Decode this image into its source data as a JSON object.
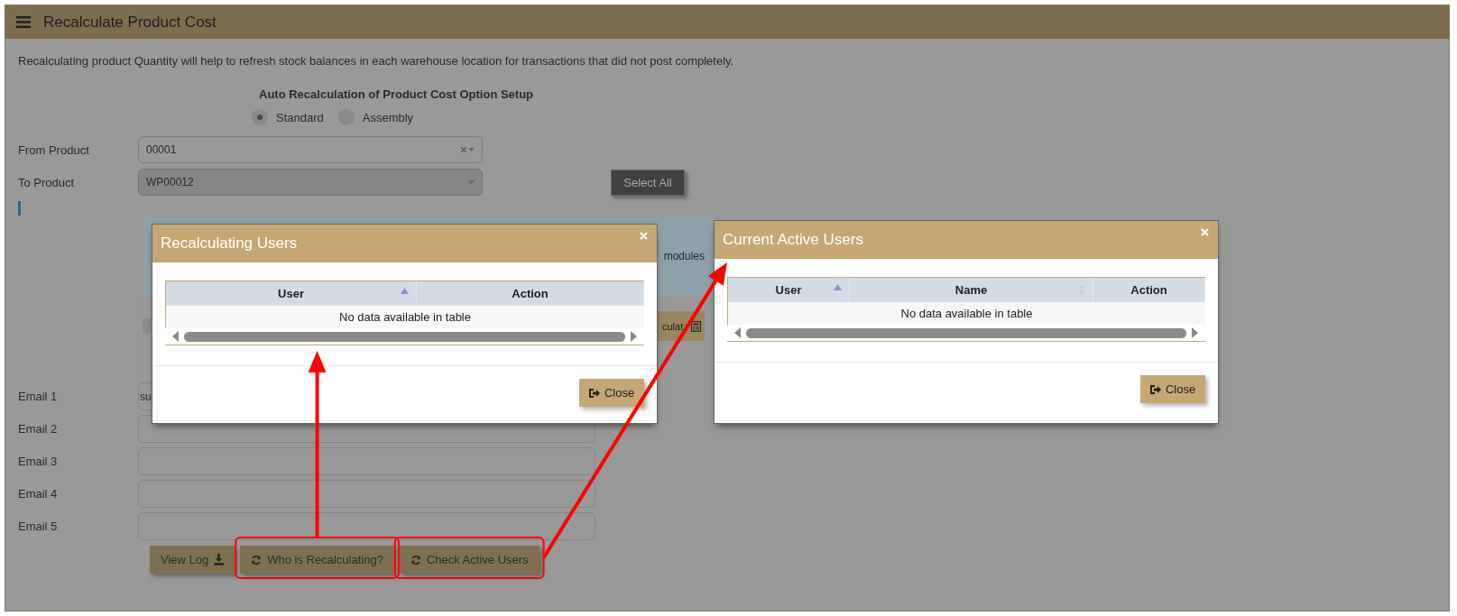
{
  "header": {
    "title": "Recalculate Product Cost"
  },
  "description": "Recalculating product Quantity will help to refresh stock balances in each warehouse location for transactions that did not post completely.",
  "option_setup": {
    "title": "Auto Recalculation of Product Cost Option Setup",
    "options": [
      {
        "label": "Standard",
        "selected": true
      },
      {
        "label": "Assembly",
        "selected": false
      }
    ]
  },
  "fields": [
    {
      "label": "From Product",
      "value": "00001",
      "clearable": true,
      "disabled": false
    },
    {
      "label": "To Product",
      "value": "WP00012",
      "clearable": false,
      "disabled": true
    }
  ],
  "select_all_button": "Select All",
  "alert_text": "modules",
  "recalculate_button": "culat",
  "emails": [
    {
      "label": "Email 1",
      "value": "su"
    },
    {
      "label": "Email 2"
    },
    {
      "label": "Email 3"
    },
    {
      "label": "Email 4"
    },
    {
      "label": "Email 5"
    }
  ],
  "buttons": [
    {
      "label": "View Log",
      "highlighted": false
    },
    {
      "label": "Who is Recalculating?",
      "highlighted": true
    },
    {
      "label": "Check Active Users",
      "highlighted": true
    }
  ],
  "modals": [
    {
      "title": "Recalculating Users",
      "columns": [
        {
          "label": "User",
          "sorted": true,
          "sortable": true
        },
        {
          "label": "Action",
          "sorted": false,
          "sortable": false
        }
      ],
      "empty_text": "No data available in table",
      "close_button": "Close"
    },
    {
      "title": "Current Active Users",
      "columns": [
        {
          "label": "User",
          "sorted": true,
          "sortable": true
        },
        {
          "label": "Name",
          "sorted": false,
          "sortable": true
        },
        {
          "label": "Action",
          "sorted": false,
          "sortable": false
        }
      ],
      "empty_text": "No data available in table",
      "close_button": "Close"
    }
  ]
}
